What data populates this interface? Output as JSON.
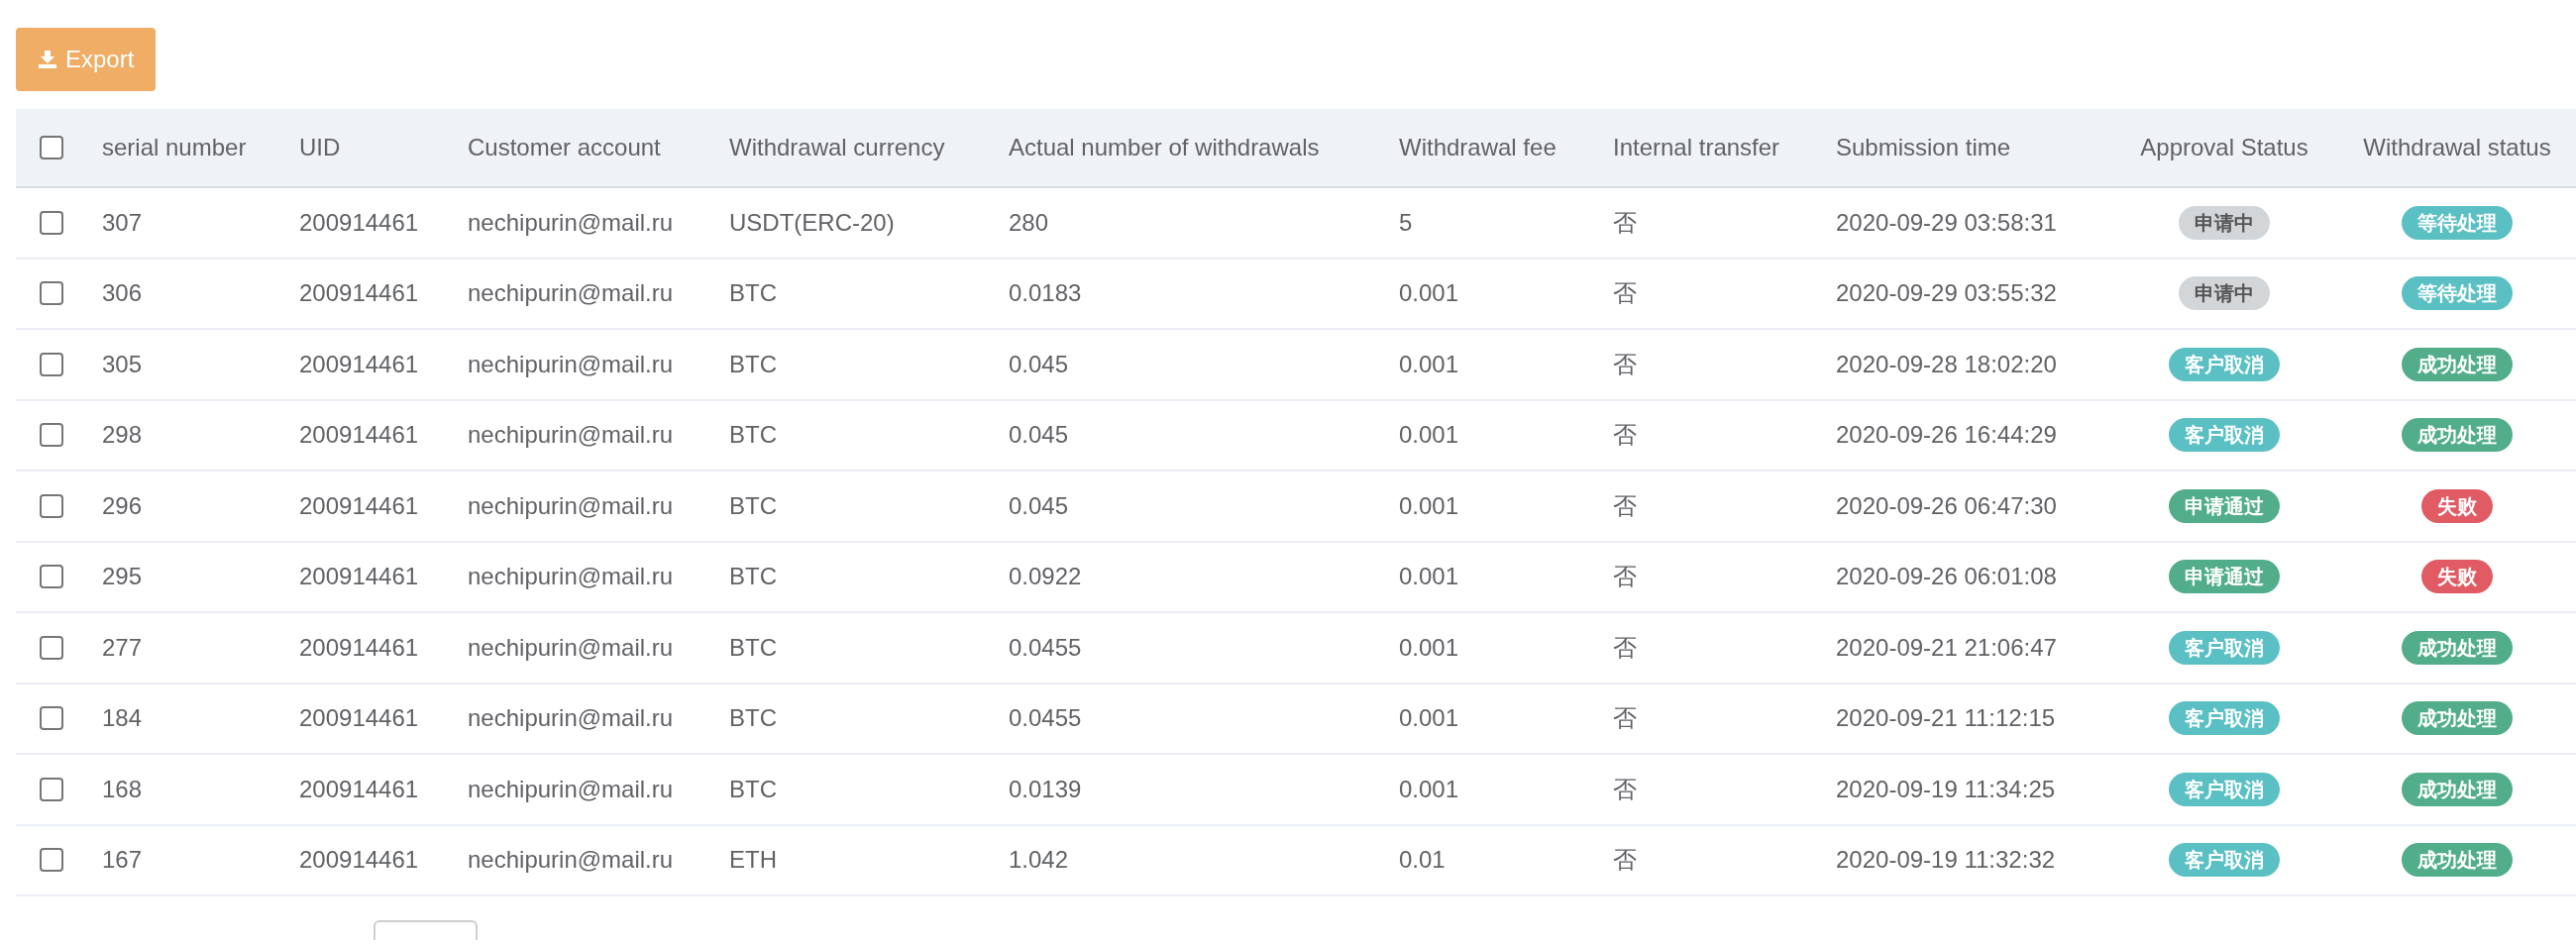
{
  "toolbar": {
    "export_button": "Export"
  },
  "table": {
    "select_all": {
      "checked": false
    },
    "columns": [
      "serial number",
      "UID",
      "Customer account",
      "Withdrawal currency",
      "Actual number of withdrawals",
      "Withdrawal fee",
      "Internal transfer",
      "Submission time",
      "Approval Status",
      "Withdrawal status"
    ],
    "rows": [
      {
        "checked": false,
        "serial": "307",
        "uid": "200914461",
        "account": "nechipurin@mail.ru",
        "currency": "USDT(ERC-20)",
        "amount": "280",
        "fee": "5",
        "internal": "否",
        "time": "2020-09-29 03:58:31",
        "approval": {
          "text": "申请中",
          "color": "#d2d6d9"
        },
        "withdrawal": {
          "text": "等待处理",
          "color": "#5bc0c4"
        }
      },
      {
        "checked": false,
        "serial": "306",
        "uid": "200914461",
        "account": "nechipurin@mail.ru",
        "currency": "BTC",
        "amount": "0.0183",
        "fee": "0.001",
        "internal": "否",
        "time": "2020-09-29 03:55:32",
        "approval": {
          "text": "申请中",
          "color": "#d2d6d9"
        },
        "withdrawal": {
          "text": "等待处理",
          "color": "#5bc0c4"
        }
      },
      {
        "checked": false,
        "serial": "305",
        "uid": "200914461",
        "account": "nechipurin@mail.ru",
        "currency": "BTC",
        "amount": "0.045",
        "fee": "0.001",
        "internal": "否",
        "time": "2020-09-28 18:02:20",
        "approval": {
          "text": "客户取消",
          "color": "#5bc0c4"
        },
        "withdrawal": {
          "text": "成功处理",
          "color": "#52ad8a"
        }
      },
      {
        "checked": false,
        "serial": "298",
        "uid": "200914461",
        "account": "nechipurin@mail.ru",
        "currency": "BTC",
        "amount": "0.045",
        "fee": "0.001",
        "internal": "否",
        "time": "2020-09-26 16:44:29",
        "approval": {
          "text": "客户取消",
          "color": "#5bc0c4"
        },
        "withdrawal": {
          "text": "成功处理",
          "color": "#52ad8a"
        }
      },
      {
        "checked": false,
        "serial": "296",
        "uid": "200914461",
        "account": "nechipurin@mail.ru",
        "currency": "BTC",
        "amount": "0.045",
        "fee": "0.001",
        "internal": "否",
        "time": "2020-09-26 06:47:30",
        "approval": {
          "text": "申请通过",
          "color": "#52ad8a"
        },
        "withdrawal": {
          "text": "失败",
          "color": "#e05b63"
        }
      },
      {
        "checked": false,
        "serial": "295",
        "uid": "200914461",
        "account": "nechipurin@mail.ru",
        "currency": "BTC",
        "amount": "0.0922",
        "fee": "0.001",
        "internal": "否",
        "time": "2020-09-26 06:01:08",
        "approval": {
          "text": "申请通过",
          "color": "#52ad8a"
        },
        "withdrawal": {
          "text": "失败",
          "color": "#e05b63"
        }
      },
      {
        "checked": false,
        "serial": "277",
        "uid": "200914461",
        "account": "nechipurin@mail.ru",
        "currency": "BTC",
        "amount": "0.0455",
        "fee": "0.001",
        "internal": "否",
        "time": "2020-09-21 21:06:47",
        "approval": {
          "text": "客户取消",
          "color": "#5bc0c4"
        },
        "withdrawal": {
          "text": "成功处理",
          "color": "#52ad8a"
        }
      },
      {
        "checked": false,
        "serial": "184",
        "uid": "200914461",
        "account": "nechipurin@mail.ru",
        "currency": "BTC",
        "amount": "0.0455",
        "fee": "0.001",
        "internal": "否",
        "time": "2020-09-21 11:12:15",
        "approval": {
          "text": "客户取消",
          "color": "#5bc0c4"
        },
        "withdrawal": {
          "text": "成功处理",
          "color": "#52ad8a"
        }
      },
      {
        "checked": false,
        "serial": "168",
        "uid": "200914461",
        "account": "nechipurin@mail.ru",
        "currency": "BTC",
        "amount": "0.0139",
        "fee": "0.001",
        "internal": "否",
        "time": "2020-09-19 11:34:25",
        "approval": {
          "text": "客户取消",
          "color": "#5bc0c4"
        },
        "withdrawal": {
          "text": "成功处理",
          "color": "#52ad8a"
        }
      },
      {
        "checked": false,
        "serial": "167",
        "uid": "200914461",
        "account": "nechipurin@mail.ru",
        "currency": "ETH",
        "amount": "1.042",
        "fee": "0.01",
        "internal": "否",
        "time": "2020-09-19 11:32:32",
        "approval": {
          "text": "客户取消",
          "color": "#5bc0c4"
        },
        "withdrawal": {
          "text": "成功处理",
          "color": "#52ad8a"
        }
      }
    ]
  }
}
